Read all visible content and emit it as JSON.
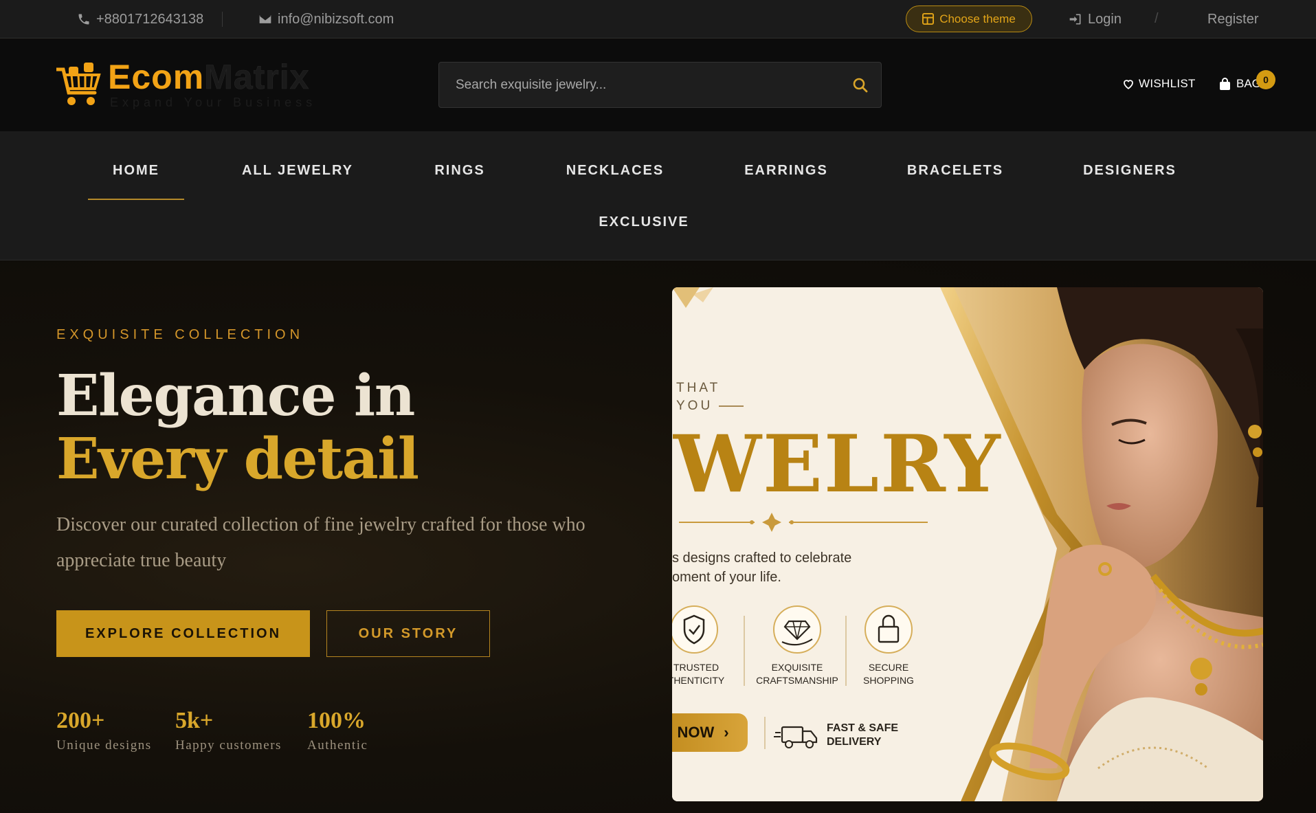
{
  "topbar": {
    "phone": "+8801712643138",
    "email": "info@nibizsoft.com",
    "theme_button": "Choose theme",
    "login": "Login",
    "separator": "/",
    "register": "Register"
  },
  "header": {
    "logo_ecom": "Ecom",
    "logo_matrix": "Matrix",
    "logo_tagline": "Expand Your Business",
    "search_placeholder": "Search exquisite jewelry...",
    "wishlist": "WISHLIST",
    "bag": "BAG",
    "bag_count": "0"
  },
  "nav": {
    "items": [
      {
        "label": "HOME",
        "active": true
      },
      {
        "label": "ALL JEWELRY"
      },
      {
        "label": "RINGS"
      },
      {
        "label": "NECKLACES"
      },
      {
        "label": "EARRINGS"
      },
      {
        "label": "BRACELETS"
      },
      {
        "label": "DESIGNERS"
      },
      {
        "label": "EXCLUSIVE"
      }
    ]
  },
  "hero": {
    "eyebrow": "EXQUISITE COLLECTION",
    "headline_line1": "Elegance in",
    "headline_line2": "Every detail",
    "subtext": "Discover our curated collection of fine jewelry crafted for those who appreciate true beauty",
    "primary_button": "EXPLORE COLLECTION",
    "secondary_button": "OUR STORY",
    "stats": [
      {
        "value": "200+",
        "label": "Unique designs"
      },
      {
        "value": "5k+",
        "label": "Happy customers"
      },
      {
        "value": "100%",
        "label": "Authentic"
      }
    ]
  },
  "banner": {
    "line1": "THAT",
    "line2": "YOU",
    "big_word": "WELRY",
    "desc_line1": "s designs crafted to celebrate",
    "desc_line2": "oment of your life.",
    "features": [
      {
        "line1": "TRUSTED",
        "line2": "THENTICITY",
        "icon": "shield-check-icon"
      },
      {
        "line1": "EXQUISITE",
        "line2": "CRAFTSMANSHIP",
        "icon": "diamond-hand-icon"
      },
      {
        "line1": "SECURE",
        "line2": "SHOPPING",
        "icon": "bag-lock-icon"
      }
    ],
    "shop_now": "NOW",
    "delivery_line1": "FAST & SAFE",
    "delivery_line2": "DELIVERY"
  },
  "colors": {
    "accent_gold": "#d9a72b",
    "button_gold": "#c8941a",
    "topbar_bg": "#1b1b1b",
    "header_bg": "#0c0c0c"
  }
}
